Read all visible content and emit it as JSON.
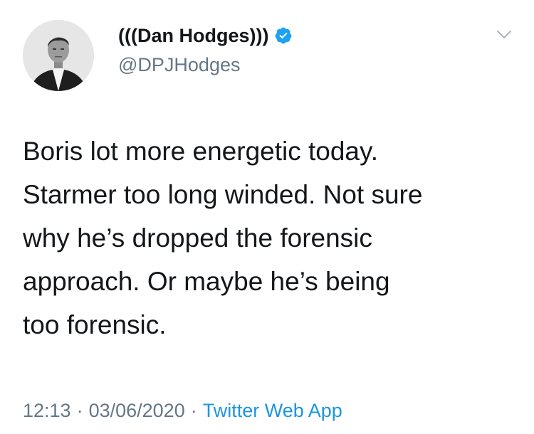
{
  "author": {
    "display_name": "(((Dan Hodges)))",
    "handle": "@DPJHodges",
    "verified": true,
    "avatar_icon": "profile-photo"
  },
  "tweet": {
    "lines": [
      "Boris lot more energetic today.",
      "Starmer too long winded. Not sure",
      "why he’s dropped the forensic",
      "approach. Or maybe he’s being",
      "too forensic."
    ]
  },
  "meta": {
    "time": "12:13",
    "separator": "·",
    "date": "03/06/2020",
    "source": "Twitter Web App"
  },
  "icons": {
    "verified": "verified-badge-icon",
    "menu": "chevron-down-icon"
  },
  "colors": {
    "text": "#14171a",
    "secondary": "#657786",
    "link": "#1b95e0",
    "verified": "#1da1f2"
  }
}
